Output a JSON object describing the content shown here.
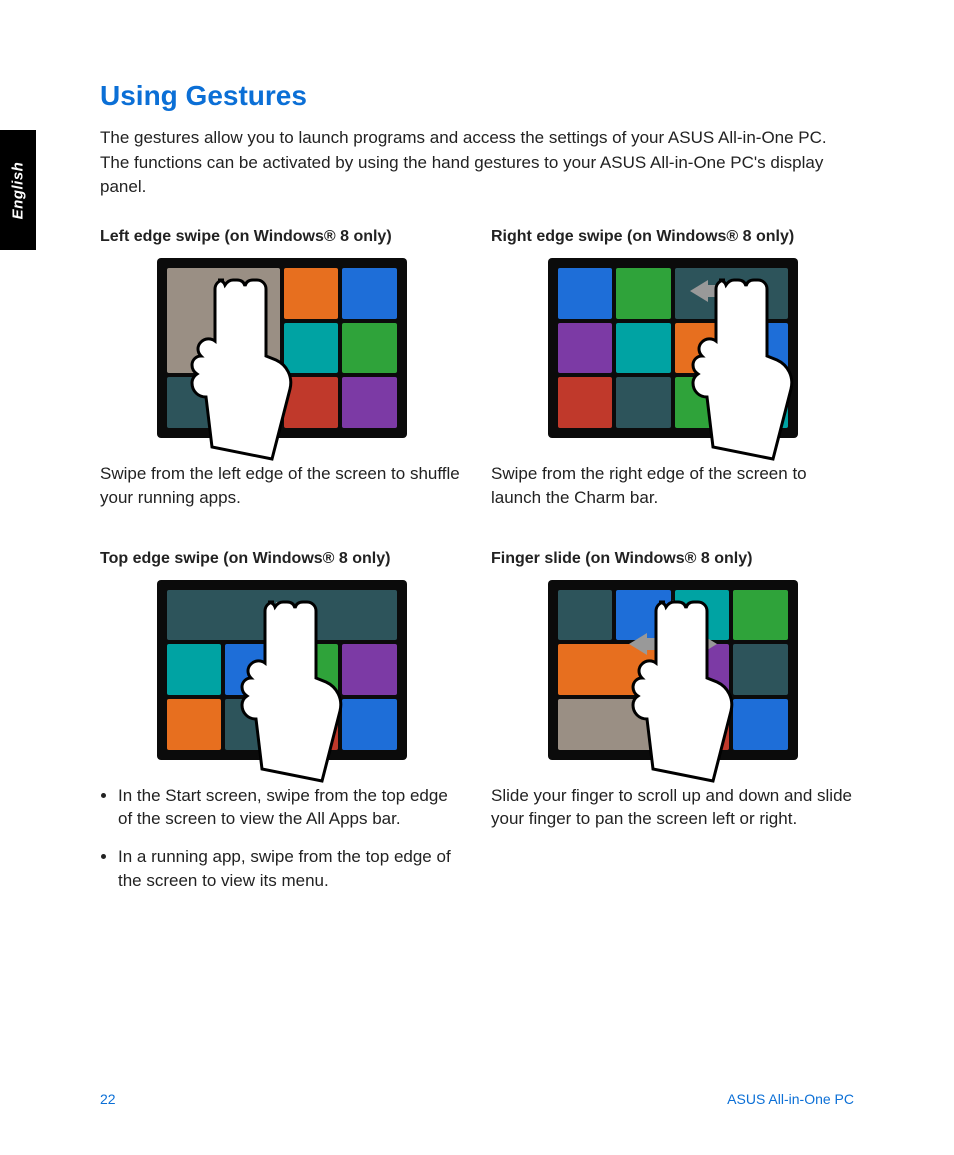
{
  "sidebar": {
    "language": "English"
  },
  "heading": "Using Gestures",
  "intro": "The gestures allow you to launch programs and access the settings of your ASUS All-in-One PC. The functions can be activated by using the hand gestures to your ASUS All-in-One PC's display panel.",
  "gestures": {
    "left_swipe": {
      "title": "Left edge swipe (on Windows® 8 only)",
      "desc": "Swipe from the left edge of the screen to shuffle your running apps."
    },
    "right_swipe": {
      "title": "Right edge swipe (on Windows® 8 only)",
      "desc": "Swipe from the right edge of the screen to launch the Charm bar."
    },
    "top_swipe": {
      "title": "Top edge swipe (on Windows® 8 only)",
      "bullet1": "In the Start screen, swipe from the top edge of the screen to view the All Apps bar.",
      "bullet2": "In a running app, swipe from the top edge of the screen to view its menu."
    },
    "finger_slide": {
      "title": "Finger slide (on Windows® 8 only)",
      "desc": "Slide your finger to scroll up and down and slide your finger to pan the screen left or right."
    }
  },
  "footer": {
    "page": "22",
    "product": "ASUS All-in-One PC"
  }
}
